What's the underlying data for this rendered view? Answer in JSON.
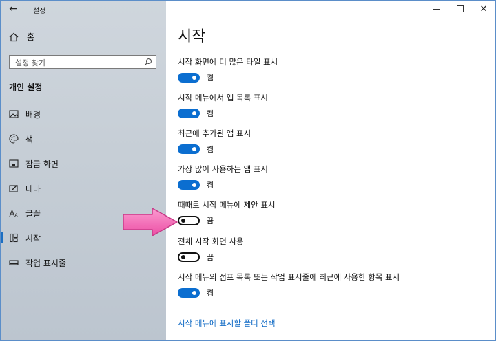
{
  "window": {
    "title": "설정",
    "back_icon": "back-arrow-icon",
    "controls": [
      "minimize-icon",
      "maximize-icon",
      "close-icon"
    ]
  },
  "sidebar": {
    "home_label": "홈",
    "search_placeholder": "설정 찾기",
    "section_title": "개인 설정",
    "items": [
      {
        "label": "배경",
        "icon": "image-icon",
        "active": false
      },
      {
        "label": "색",
        "icon": "palette-icon",
        "active": false
      },
      {
        "label": "잠금 화면",
        "icon": "lock-screen-icon",
        "active": false
      },
      {
        "label": "테마",
        "icon": "theme-icon",
        "active": false
      },
      {
        "label": "글꼴",
        "icon": "font-icon",
        "active": false
      },
      {
        "label": "시작",
        "icon": "start-icon",
        "active": true
      },
      {
        "label": "작업 표시줄",
        "icon": "taskbar-icon",
        "active": false
      }
    ]
  },
  "main": {
    "title": "시작",
    "settings": [
      {
        "label": "시작 화면에 더 많은 타일 표시",
        "on": true,
        "state": "켬"
      },
      {
        "label": "시작 메뉴에서 앱 목록 표시",
        "on": true,
        "state": "켬"
      },
      {
        "label": "최근에 추가된 앱 표시",
        "on": true,
        "state": "켬"
      },
      {
        "label": "가장 많이 사용하는 앱 표시",
        "on": true,
        "state": "켬"
      },
      {
        "label": "때때로 시작 메뉴에 제안 표시",
        "on": false,
        "state": "끔"
      },
      {
        "label": "전체 시작 화면 사용",
        "on": false,
        "state": "끔"
      },
      {
        "label": "시작 메뉴의 점프 목록 또는 작업 표시줄에 최근에 사용한 항목 표시",
        "on": true,
        "state": "켬"
      }
    ],
    "folder_link": "시작 메뉴에 표시할 폴더 선택"
  },
  "colors": {
    "accent": "#0b6ed0",
    "link": "#0c68c4",
    "annotation_arrow": "#f06ab0"
  }
}
